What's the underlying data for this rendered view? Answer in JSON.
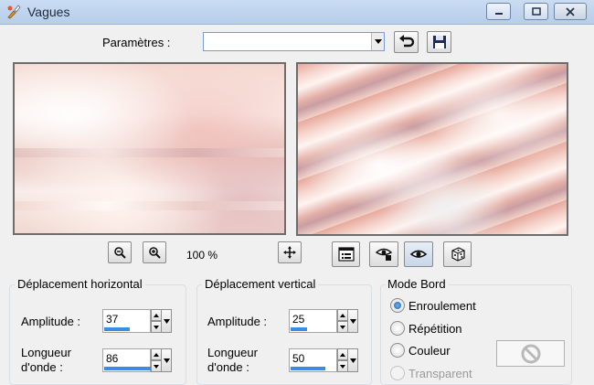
{
  "window": {
    "title": "Vagues"
  },
  "toolbar": {
    "params_label": "Paramètres :",
    "params_value": "",
    "zoom_level": "100 %"
  },
  "horizontal": {
    "title": "Déplacement horizontal",
    "amplitude_label": "Amplitude :",
    "amplitude_value": "37",
    "wavelength_label_1": "Longueur",
    "wavelength_label_2": "d'onde :",
    "wavelength_value": "86"
  },
  "vertical": {
    "title": "Déplacement vertical",
    "amplitude_label": "Amplitude :",
    "amplitude_value": "25",
    "wavelength_label_1": "Longueur",
    "wavelength_label_2": "d'onde :",
    "wavelength_value": "50"
  },
  "edge_mode": {
    "title": "Mode Bord",
    "options": [
      "Enroulement",
      "Répétition",
      "Couleur",
      "Transparent"
    ],
    "selected": "Enroulement"
  },
  "colors": {
    "accent": "#3a8de0",
    "titlebar": "#c4d8ef"
  }
}
